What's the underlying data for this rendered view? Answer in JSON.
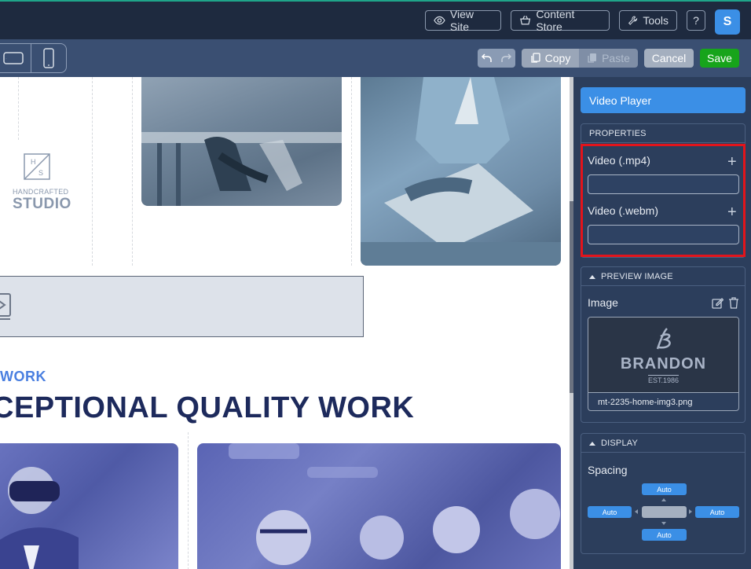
{
  "header": {
    "view_site": "View Site",
    "content_store": "Content Store",
    "tools": "Tools",
    "help": "?",
    "avatar_initial": "S"
  },
  "toolbar": {
    "copy": "Copy",
    "paste": "Paste",
    "cancel": "Cancel",
    "save": "Save"
  },
  "canvas": {
    "logo_line1": "HANDCRAFTED",
    "logo_line2": "STUDIO",
    "logo_mark": "H/S",
    "work_label": "WORK",
    "headline": "CEPTIONAL QUALITY WORK"
  },
  "panel": {
    "title": "Video Player",
    "properties_header": "PROPERTIES",
    "video_mp4_label": "Video (.mp4)",
    "video_mp4_value": "",
    "video_webm_label": "Video (.webm)",
    "video_webm_value": "",
    "preview_header": "PREVIEW IMAGE",
    "image_label": "Image",
    "image_brand": "BRANDON",
    "image_est": "EST.1986",
    "image_filename": "mt-2235-home-img3.png",
    "display_header": "DISPLAY",
    "spacing_label": "Spacing",
    "spacing": {
      "top": "Auto",
      "left": "Auto",
      "right": "Auto",
      "bottom": "Auto"
    }
  },
  "colors": {
    "accent": "#3b8fe6",
    "save": "#17a41b",
    "highlight": "#e3141b"
  }
}
